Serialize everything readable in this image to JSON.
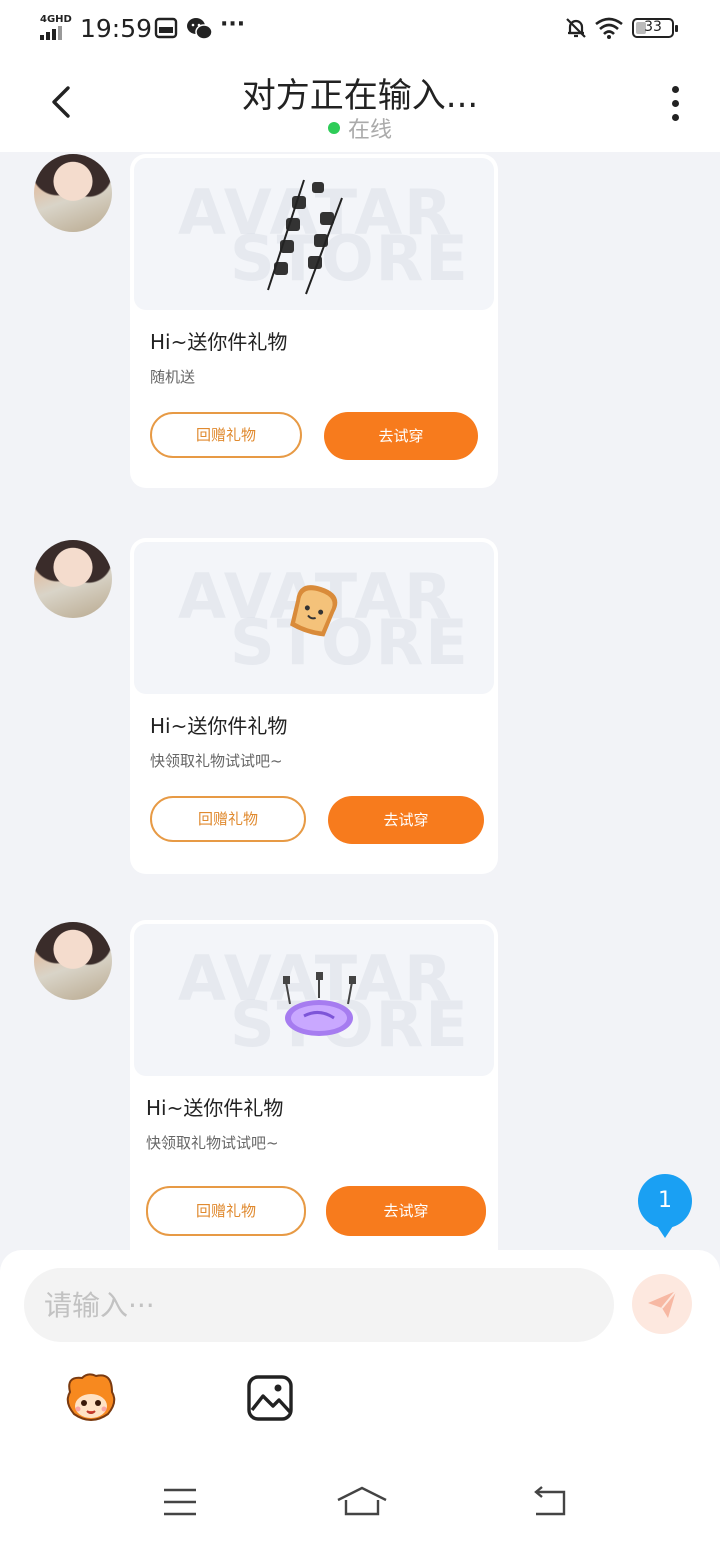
{
  "status_bar": {
    "network": "4GHD",
    "time": "19:59",
    "battery": "33"
  },
  "header": {
    "title": "对方正在输入...",
    "status": "在线"
  },
  "messages": [
    {
      "title": "Hi~送你件礼物",
      "subtitle": "随机送",
      "return_label": "回赠礼物",
      "try_label": "去试穿",
      "image_alt": "skewer gift"
    },
    {
      "title": "Hi~送你件礼物",
      "subtitle": "快领取礼物试试吧~",
      "return_label": "回赠礼物",
      "try_label": "去试穿",
      "image_alt": "toast gift"
    },
    {
      "title": "Hi~送你件礼物",
      "subtitle": "快领取礼物试试吧~",
      "return_label": "回赠礼物",
      "try_label": "去试穿",
      "image_alt": "purple disc gift"
    }
  ],
  "watermark": {
    "line1": "AVATAR",
    "line2": "STORE"
  },
  "unread_count": "1",
  "input": {
    "placeholder": "请输入···"
  },
  "colors": {
    "accent": "#f77b1d",
    "online": "#2ecc58",
    "badge": "#1aa0f3"
  }
}
